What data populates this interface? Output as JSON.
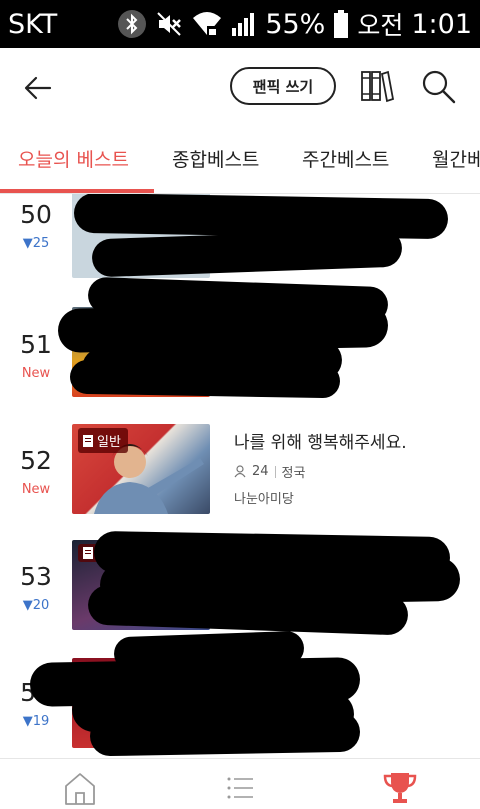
{
  "status_bar": {
    "carrier": "SKT",
    "battery_percent": "55%",
    "ampm": "오전",
    "time": "1:01",
    "icons": [
      "bluetooth-icon",
      "mute-icon",
      "wifi-icon",
      "signal-icon",
      "battery-icon"
    ]
  },
  "header": {
    "back_icon": "arrow-left-icon",
    "write_button": "팬픽 쓰기",
    "library_icon": "library-icon",
    "search_icon": "search-icon"
  },
  "tabs": [
    {
      "label": "오늘의 베스트",
      "active": true
    },
    {
      "label": "종합베스트",
      "active": false
    },
    {
      "label": "주간베스트",
      "active": false
    },
    {
      "label": "월간베",
      "active": false
    }
  ],
  "rankings": [
    {
      "rank": "50",
      "change": "▼25",
      "change_type": "down",
      "redacted": true
    },
    {
      "rank": "51",
      "change": "New",
      "change_type": "new",
      "redacted": true
    },
    {
      "rank": "52",
      "change": "New",
      "change_type": "new",
      "badge": "일반",
      "title": "나를 위해 행복해주세요.",
      "subscribers": "24",
      "character": "정국",
      "author": "나눈아미당",
      "redacted": false
    },
    {
      "rank": "53",
      "change": "▼20",
      "change_type": "down",
      "redacted": true
    },
    {
      "rank": "54",
      "change": "▼19",
      "change_type": "down",
      "redacted": true
    }
  ],
  "bottom_nav": [
    {
      "icon": "home-icon",
      "active": false
    },
    {
      "icon": "list-icon",
      "active": false
    },
    {
      "icon": "trophy-icon",
      "active": true
    }
  ],
  "colors": {
    "accent": "#e8534f",
    "rank_down": "#3d74c9"
  }
}
